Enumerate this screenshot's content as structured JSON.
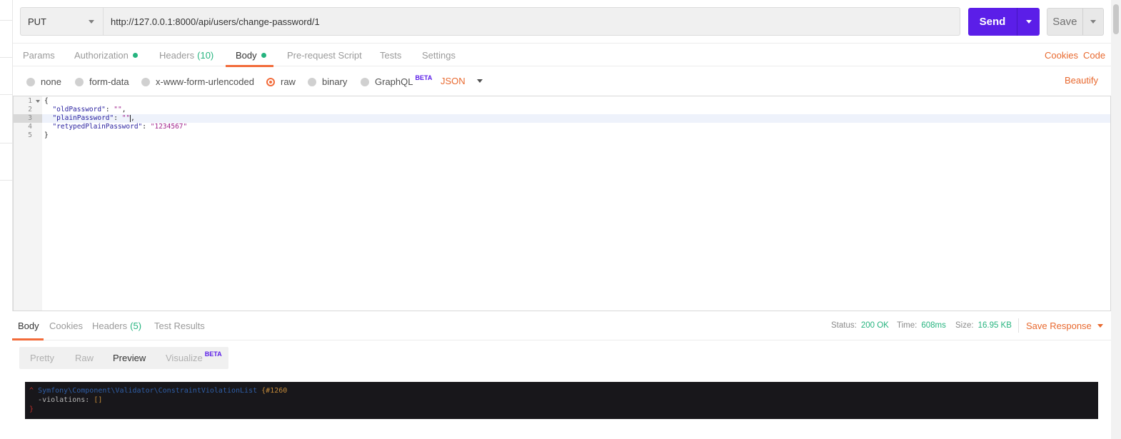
{
  "request": {
    "method": "PUT",
    "url": "http://127.0.0.1:8000/api/users/change-password/1",
    "send_label": "Send",
    "save_label": "Save"
  },
  "request_tabs": [
    {
      "label": "Params",
      "count": "",
      "dot": false,
      "active": false
    },
    {
      "label": "Authorization",
      "count": "",
      "dot": true,
      "active": false
    },
    {
      "label": "Headers",
      "count": "(10)",
      "dot": false,
      "active": false
    },
    {
      "label": "Body",
      "count": "",
      "dot": true,
      "active": true
    },
    {
      "label": "Pre-request Script",
      "count": "",
      "dot": false,
      "active": false
    },
    {
      "label": "Tests",
      "count": "",
      "dot": false,
      "active": false
    },
    {
      "label": "Settings",
      "count": "",
      "dot": false,
      "active": false
    }
  ],
  "request_links": {
    "cookies": "Cookies",
    "code": "Code"
  },
  "body_options": {
    "radios": [
      {
        "label": "none",
        "selected": false,
        "badge": ""
      },
      {
        "label": "form-data",
        "selected": false,
        "badge": ""
      },
      {
        "label": "x-www-form-urlencoded",
        "selected": false,
        "badge": ""
      },
      {
        "label": "raw",
        "selected": true,
        "badge": ""
      },
      {
        "label": "binary",
        "selected": false,
        "badge": ""
      },
      {
        "label": "GraphQL",
        "selected": false,
        "badge": "BETA"
      }
    ],
    "format": "JSON",
    "beautify": "Beautify"
  },
  "editor": {
    "lines": [
      {
        "n": "1",
        "text": "{"
      },
      {
        "n": "2",
        "key": "\"oldPassword\"",
        "sep": ": ",
        "value": "\"\"",
        "end": ","
      },
      {
        "n": "3",
        "key": "\"plainPassword\"",
        "sep": ": ",
        "value": "\"\"",
        "end": ","
      },
      {
        "n": "4",
        "key": "\"retypedPlainPassword\"",
        "sep": ": ",
        "value": "\"1234567\"",
        "end": ""
      },
      {
        "n": "5",
        "text": "}"
      }
    ]
  },
  "response_tabs": [
    {
      "label": "Body",
      "count": "",
      "active": true
    },
    {
      "label": "Cookies",
      "count": "",
      "active": false
    },
    {
      "label": "Headers",
      "count": "(5)",
      "active": false
    },
    {
      "label": "Test Results",
      "count": "",
      "active": false
    }
  ],
  "response_meta": {
    "status_label": "Status:",
    "status_value": "200 OK",
    "time_label": "Time:",
    "time_value": "608ms",
    "size_label": "Size:",
    "size_value": "16.95 KB",
    "save_response": "Save Response"
  },
  "view_modes": [
    {
      "label": "Pretty",
      "active": false,
      "badge": ""
    },
    {
      "label": "Raw",
      "active": false,
      "badge": ""
    },
    {
      "label": "Preview",
      "active": true,
      "badge": ""
    },
    {
      "label": "Visualize",
      "active": false,
      "badge": "BETA"
    }
  ],
  "dump": {
    "caret": "^",
    "class_name": "Symfony\\Component\\Validator\\ConstraintViolationList",
    "id": "{#1260",
    "prop": "-violations",
    "prop_sep": ": ",
    "prop_value": "[]",
    "close": "}"
  },
  "colors": {
    "accent_orange": "#f26b3a",
    "send_purple": "#5b1ee8",
    "status_green": "#26b47f"
  }
}
